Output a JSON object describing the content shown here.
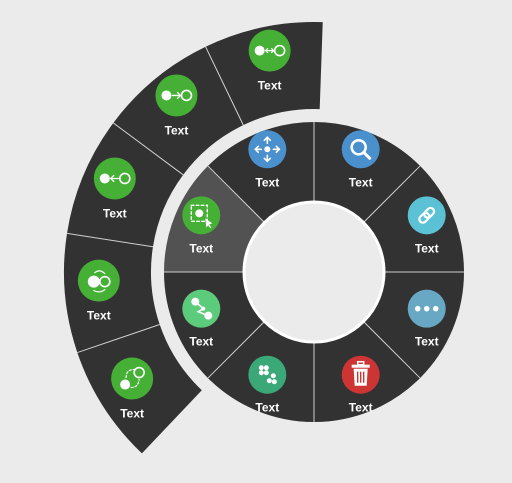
{
  "radial_menu": {
    "colors": {
      "segment": "#323232",
      "segment_selected": "#525252",
      "divider": "#cfcfcf",
      "center": "#ebebeb"
    },
    "inner_items": [
      {
        "label": "Text",
        "icon": "move-arrows-icon",
        "color": "#4a90cc",
        "selected": false
      },
      {
        "label": "Text",
        "icon": "select-cursor-icon",
        "color": "#45b035",
        "selected": true
      },
      {
        "label": "Text",
        "icon": "share-nodes-icon",
        "color": "#5dcb7c",
        "selected": false
      },
      {
        "label": "Text",
        "icon": "scatter-nodes-icon",
        "color": "#3aa877",
        "selected": false
      },
      {
        "label": "Text",
        "icon": "trash-icon",
        "color": "#cd3535",
        "selected": false
      },
      {
        "label": "Text",
        "icon": "more-dots-icon",
        "color": "#68a8c5",
        "selected": false
      },
      {
        "label": "Text",
        "icon": "link-icon",
        "color": "#5bc2d6",
        "selected": false
      },
      {
        "label": "Text",
        "icon": "search-icon",
        "color": "#4a90cc",
        "selected": false
      }
    ],
    "outer_items": [
      {
        "label": "Text",
        "icon": "bidirectional-connect-icon",
        "color": "#45b035"
      },
      {
        "label": "Text",
        "icon": "connect-right-icon",
        "color": "#45b035"
      },
      {
        "label": "Text",
        "icon": "connect-left-icon",
        "color": "#45b035"
      },
      {
        "label": "Text",
        "icon": "swap-cycle-icon",
        "color": "#45b035"
      },
      {
        "label": "Text",
        "icon": "dashed-path-icon",
        "color": "#45b035"
      }
    ]
  }
}
